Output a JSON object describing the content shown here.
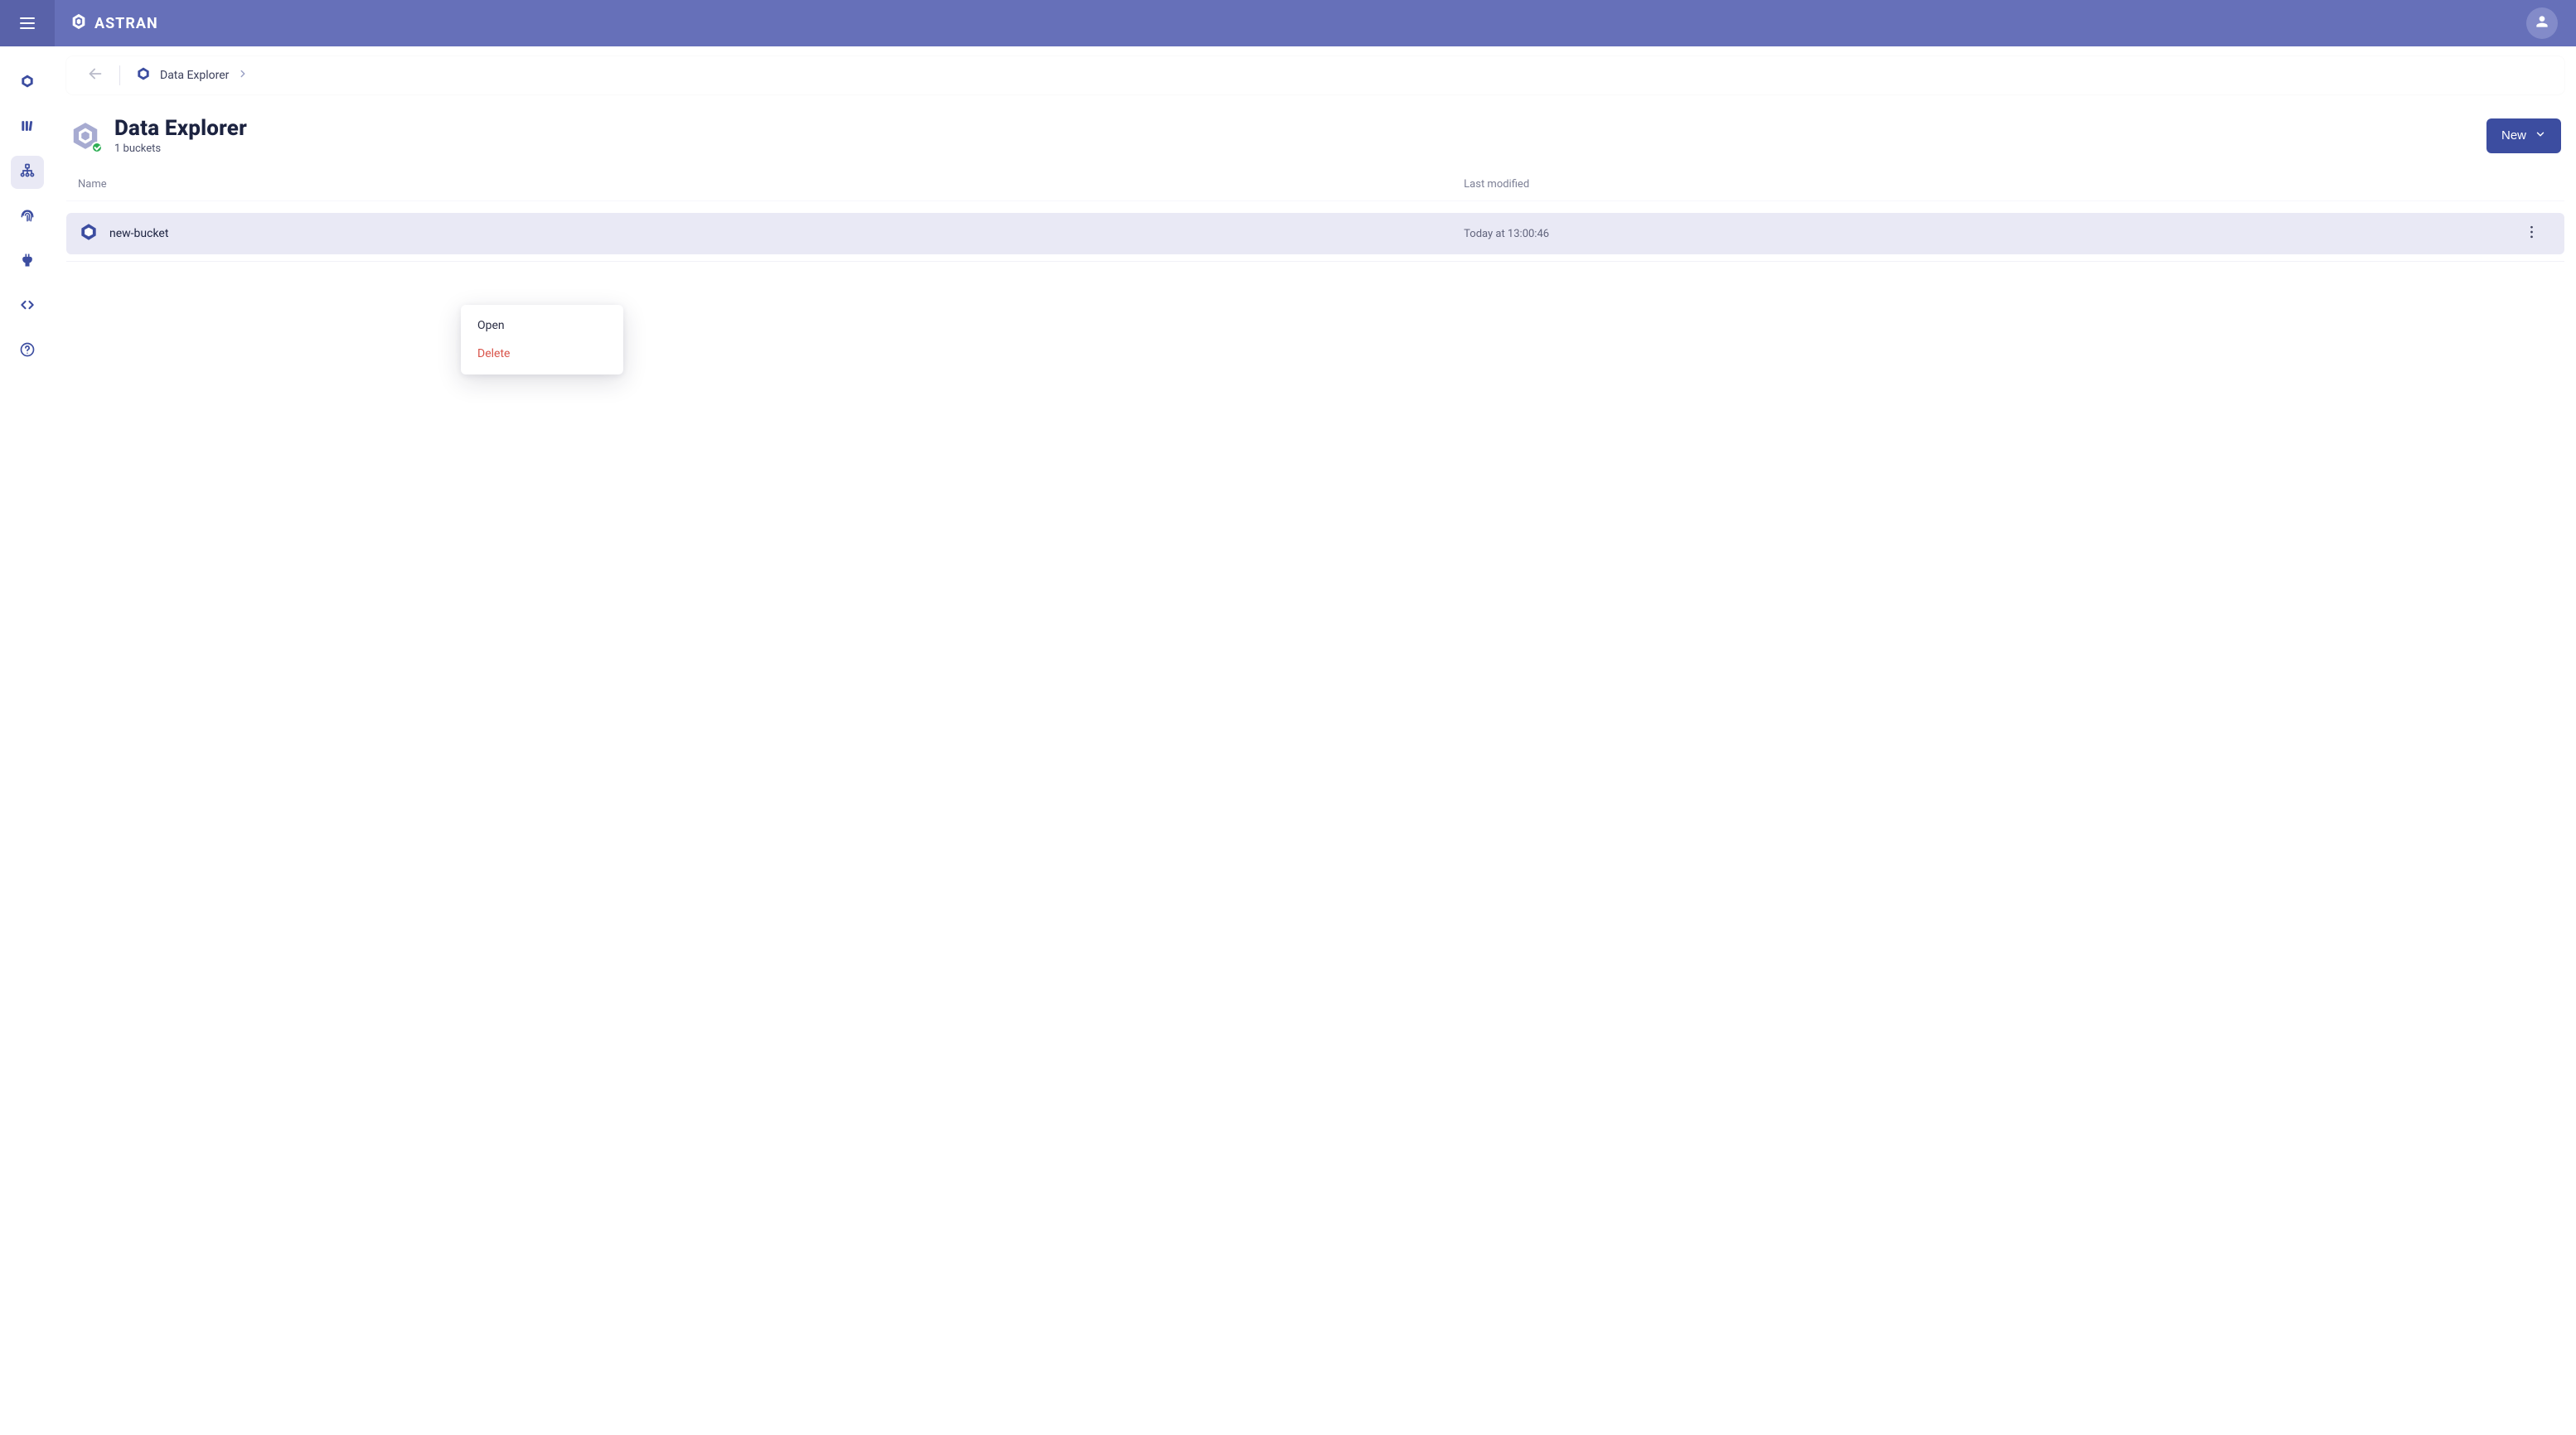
{
  "brand": {
    "name": "ASTRAN"
  },
  "breadcrumb": {
    "label": "Data Explorer"
  },
  "page": {
    "title": "Data Explorer",
    "subtitle": "1 buckets",
    "new_button_label": "New"
  },
  "table": {
    "columns": {
      "name": "Name",
      "modified": "Last modified"
    },
    "rows": [
      {
        "name": "new-bucket",
        "modified": "Today at 13:00:46"
      }
    ]
  },
  "context_menu": {
    "open": "Open",
    "delete": "Delete"
  }
}
